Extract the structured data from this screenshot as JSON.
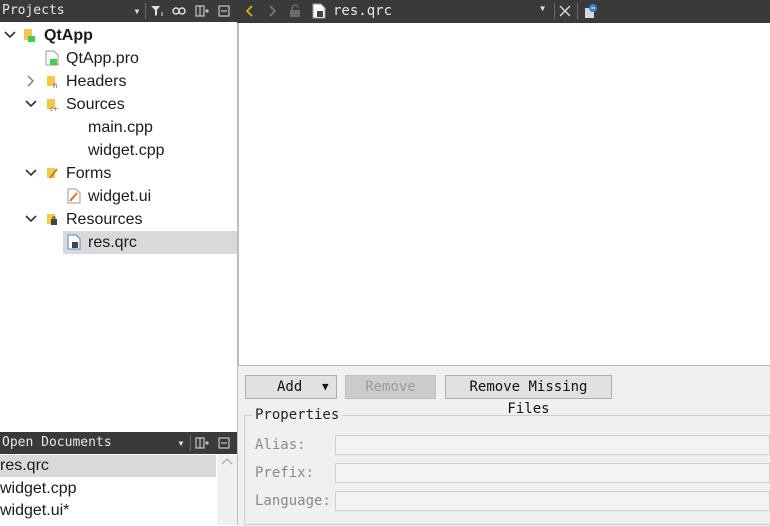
{
  "projects_panel": {
    "title": "Projects",
    "tree": [
      {
        "label": "QtApp",
        "bold": true
      },
      {
        "label": "QtApp.pro"
      },
      {
        "label": "Headers"
      },
      {
        "label": "Sources"
      },
      {
        "label": "main.cpp"
      },
      {
        "label": "widget.cpp"
      },
      {
        "label": "Forms"
      },
      {
        "label": "widget.ui"
      },
      {
        "label": "Resources"
      },
      {
        "label": "res.qrc",
        "selected": true
      }
    ]
  },
  "open_documents": {
    "title": "Open Documents",
    "items": [
      "res.qrc",
      "widget.cpp",
      "widget.ui*"
    ]
  },
  "editor": {
    "filename": "res.qrc"
  },
  "resource_editor": {
    "add_label": "Add",
    "remove_label": "Remove",
    "remove_missing_label": "Remove Missing Files",
    "properties_title": "Properties",
    "alias_label": "Alias:",
    "prefix_label": "Prefix:",
    "language_label": "Language:"
  },
  "colors": {
    "toolbar_bg": "#3a3a3a",
    "selection_bg": "#d9d9d9",
    "nav_arrow": "#e0b000"
  }
}
